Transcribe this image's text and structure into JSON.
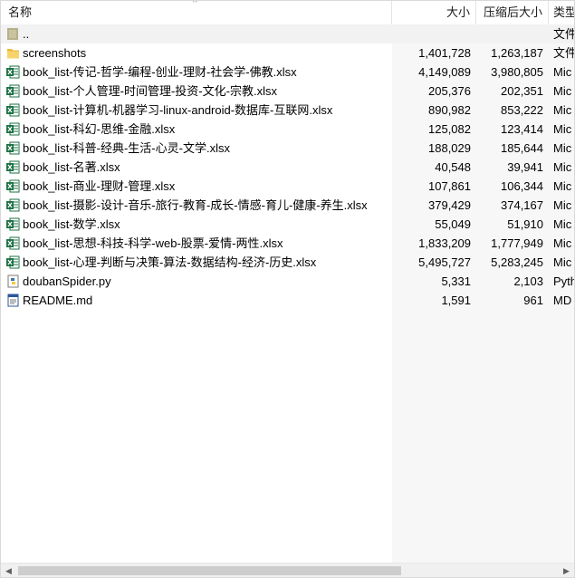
{
  "columns": {
    "name": "名称",
    "size": "大小",
    "packed": "压缩后大小",
    "type": "类型"
  },
  "rows": [
    {
      "name": "..",
      "size": "",
      "packed": "",
      "type": "文件",
      "icon": "folder-up-icon"
    },
    {
      "name": "screenshots",
      "size": "1,401,728",
      "packed": "1,263,187",
      "type": "文件",
      "icon": "folder-icon"
    },
    {
      "name": "book_list-传记-哲学-编程-创业-理财-社会学-佛教.xlsx",
      "size": "4,149,089",
      "packed": "3,980,805",
      "type": "Mic",
      "icon": "excel-icon"
    },
    {
      "name": "book_list-个人管理-时间管理-投资-文化-宗教.xlsx",
      "size": "205,376",
      "packed": "202,351",
      "type": "Mic",
      "icon": "excel-icon"
    },
    {
      "name": "book_list-计算机-机器学习-linux-android-数据库-互联网.xlsx",
      "size": "890,982",
      "packed": "853,222",
      "type": "Mic",
      "icon": "excel-icon"
    },
    {
      "name": "book_list-科幻-思维-金融.xlsx",
      "size": "125,082",
      "packed": "123,414",
      "type": "Mic",
      "icon": "excel-icon"
    },
    {
      "name": "book_list-科普-经典-生活-心灵-文学.xlsx",
      "size": "188,029",
      "packed": "185,644",
      "type": "Mic",
      "icon": "excel-icon"
    },
    {
      "name": "book_list-名著.xlsx",
      "size": "40,548",
      "packed": "39,941",
      "type": "Mic",
      "icon": "excel-icon"
    },
    {
      "name": "book_list-商业-理财-管理.xlsx",
      "size": "107,861",
      "packed": "106,344",
      "type": "Mic",
      "icon": "excel-icon"
    },
    {
      "name": "book_list-摄影-设计-音乐-旅行-教育-成长-情感-育儿-健康-养生.xlsx",
      "size": "379,429",
      "packed": "374,167",
      "type": "Mic",
      "icon": "excel-icon"
    },
    {
      "name": "book_list-数学.xlsx",
      "size": "55,049",
      "packed": "51,910",
      "type": "Mic",
      "icon": "excel-icon"
    },
    {
      "name": "book_list-思想-科技-科学-web-股票-爱情-两性.xlsx",
      "size": "1,833,209",
      "packed": "1,777,949",
      "type": "Mic",
      "icon": "excel-icon"
    },
    {
      "name": "book_list-心理-判断与决策-算法-数据结构-经济-历史.xlsx",
      "size": "5,495,727",
      "packed": "5,283,245",
      "type": "Mic",
      "icon": "excel-icon"
    },
    {
      "name": "doubanSpider.py",
      "size": "5,331",
      "packed": "2,103",
      "type": "Pyth",
      "icon": "python-icon"
    },
    {
      "name": "README.md",
      "size": "1,591",
      "packed": "961",
      "type": "MD",
      "icon": "document-icon"
    }
  ],
  "colors": {
    "excel_green": "#1e7145",
    "folder_yellow": "#f4c542",
    "scroll_thumb": "#cdcdcd"
  }
}
